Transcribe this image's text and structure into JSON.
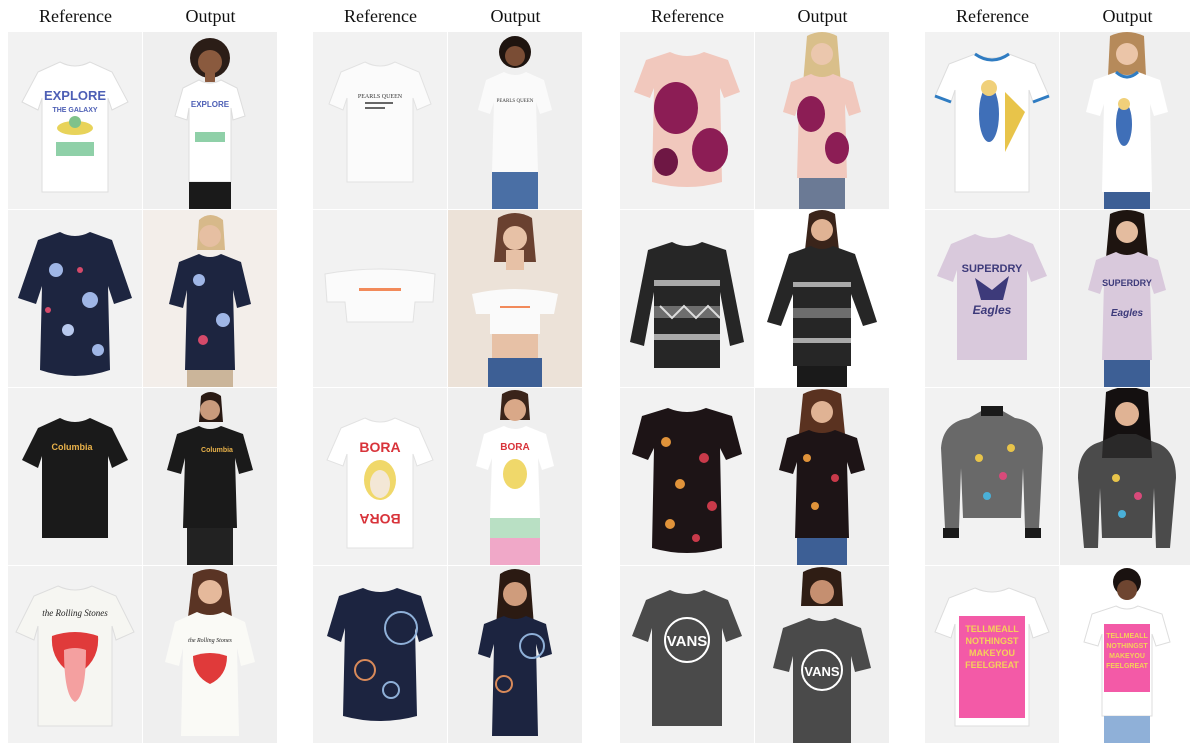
{
  "columns": [
    {
      "reference_label": "Reference",
      "output_label": "Output"
    },
    {
      "reference_label": "Reference",
      "output_label": "Output"
    },
    {
      "reference_label": "Reference",
      "output_label": "Output"
    },
    {
      "reference_label": "Reference",
      "output_label": "Output"
    }
  ],
  "prints": {
    "explore_1": "EXPLORE",
    "explore_2": "THE GALAXY",
    "columbia": "Columbia",
    "stones": "the Rolling Stones",
    "pearls_1": "PEARLS QUEEN",
    "bora": "BORA",
    "vans": "VANS",
    "superdry": "SUPERDRY",
    "eagles": "Eagles",
    "tellme_1": "TELLMEALL",
    "tellme_2": "NOTHINGST",
    "tellme_3": "MAKEYOU",
    "tellme_4": "FEELGREAT"
  },
  "colors": {
    "tee_white": "#ffffff",
    "navy_floral": "#1d2540",
    "black_tee": "#1a1a1a",
    "pink_floral": "#f1c8bd",
    "magenta": "#8c1d55",
    "charcoal_tee": "#4a4a4a",
    "lilac_tee": "#d9c9dc",
    "hot_pink": "#f35aa7"
  }
}
